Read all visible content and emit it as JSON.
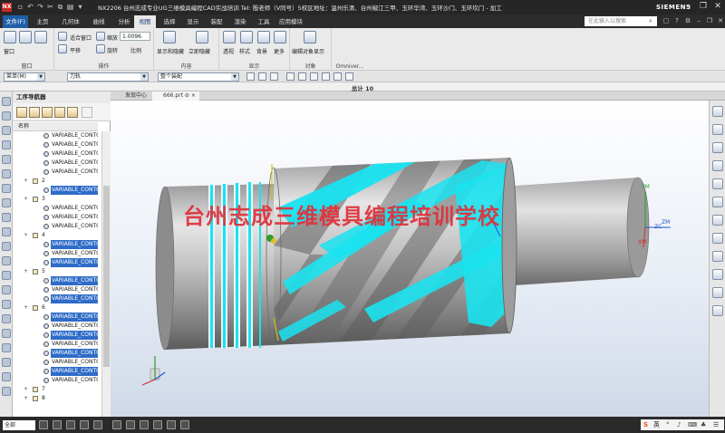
{
  "window": {
    "app_badge": "NX",
    "title": "NX2206 台州志成专业UG三维模具编程CAD实战培训  Tel:                    殷老师（V同号）5校区地址：温州乐清、台州椒江三甲、玉环华湾、玉环沙门、玉环坎门 - 加工",
    "brand": "SIEMENS",
    "minimize": "–",
    "restore": "❐",
    "close": "✕"
  },
  "tabs": [
    {
      "label": "文件(F)"
    },
    {
      "label": "主页"
    },
    {
      "label": "几何体"
    },
    {
      "label": "曲线"
    },
    {
      "label": "分析"
    },
    {
      "label": "视图"
    },
    {
      "label": "选择"
    },
    {
      "label": "显示"
    },
    {
      "label": "装配"
    },
    {
      "label": "渲染"
    },
    {
      "label": "工具"
    },
    {
      "label": "应用模块"
    }
  ],
  "search": {
    "placeholder": "在此输入以搜索"
  },
  "ribbon": {
    "window_group": {
      "label": "窗口",
      "btn": "窗口"
    },
    "operation_group": {
      "label": "操作",
      "fit_window": "适合窗口",
      "scale": "缩放",
      "scale_value": "1.0096",
      "pan": "平移",
      "rotate": "旋转",
      "ratio": "比例"
    },
    "content_group": {
      "label": "内容",
      "show_hide": "显示和隐藏",
      "instant_hide": "立即隐藏"
    },
    "display_group": {
      "label": "显示",
      "perspective": "透视",
      "style": "样式",
      "background": "背景",
      "more": "更多"
    },
    "object_group": {
      "label": "对象",
      "edit_display": "编辑对象显示"
    },
    "omni_group": {
      "label": "Omniver..."
    }
  },
  "selection_bar": {
    "menu": "菜单(M)",
    "filter1": "刀轨",
    "filter2": "整个装配"
  },
  "doc_title": "总计 10",
  "graphics_tabs": [
    {
      "label": "发现中心"
    },
    {
      "label": "666.prt ⊘ ×"
    }
  ],
  "navigator": {
    "title": "工序导航器",
    "column_header": "名称",
    "rows": [
      {
        "type": "op",
        "label": "VARIABLE_CONTO",
        "selected": false
      },
      {
        "type": "op",
        "label": "VARIABLE_CONTO",
        "selected": false
      },
      {
        "type": "op",
        "label": "VARIABLE_CONTO",
        "selected": false
      },
      {
        "type": "op",
        "label": "VARIABLE_CONTO",
        "selected": false
      },
      {
        "type": "op",
        "label": "VARIABLE_CONTO",
        "selected": false
      },
      {
        "type": "group",
        "label": "2",
        "selected": false
      },
      {
        "type": "op",
        "label": "VARIABLE_CONTO",
        "selected": true
      },
      {
        "type": "group",
        "label": "3",
        "selected": false
      },
      {
        "type": "op",
        "label": "VARIABLE_CONTO",
        "selected": false
      },
      {
        "type": "op",
        "label": "VARIABLE_CONTO",
        "selected": false
      },
      {
        "type": "op",
        "label": "VARIABLE_CONTO",
        "selected": false
      },
      {
        "type": "group",
        "label": "4",
        "selected": false
      },
      {
        "type": "op",
        "label": "VARIABLE_CONTO",
        "selected": true
      },
      {
        "type": "op",
        "label": "VARIABLE_CONTO",
        "selected": false
      },
      {
        "type": "op",
        "label": "VARIABLE_CONTO",
        "selected": true
      },
      {
        "type": "group",
        "label": "5",
        "selected": false
      },
      {
        "type": "op",
        "label": "VARIABLE_CONTO",
        "selected": true
      },
      {
        "type": "op",
        "label": "VARIABLE_CONTO",
        "selected": false
      },
      {
        "type": "op",
        "label": "VARIABLE_CONTO",
        "selected": true
      },
      {
        "type": "group",
        "label": "6",
        "selected": false
      },
      {
        "type": "op",
        "label": "VARIABLE_CONTO",
        "selected": true
      },
      {
        "type": "op",
        "label": "VARIABLE_CONTO",
        "selected": false
      },
      {
        "type": "op",
        "label": "VARIABLE_CONTO",
        "selected": true
      },
      {
        "type": "op",
        "label": "VARIABLE_CONTO",
        "selected": false
      },
      {
        "type": "op",
        "label": "VARIABLE_CONTO",
        "selected": true
      },
      {
        "type": "op",
        "label": "VARIABLE_CONTO",
        "selected": false
      },
      {
        "type": "op",
        "label": "VARIABLE_CONTO",
        "selected": true
      },
      {
        "type": "op",
        "label": "VARIABLE_CONTO",
        "selected": false
      },
      {
        "type": "group",
        "label": "7",
        "selected": false
      },
      {
        "type": "group",
        "label": "8",
        "selected": false
      }
    ]
  },
  "viewport": {
    "watermark": "台州志成三维模具编程培训学校",
    "axis_labels": {
      "zm": "ZM",
      "zc": "ZC",
      "ym": "YM",
      "xm": "XM"
    }
  },
  "status": {
    "filter": "全部",
    "ime": "英"
  },
  "colors": {
    "toolpath": "#19e3f0",
    "selected_row": "#2e6cc8",
    "watermark": "#e0303a",
    "file_tab": "#1f5fa8"
  }
}
